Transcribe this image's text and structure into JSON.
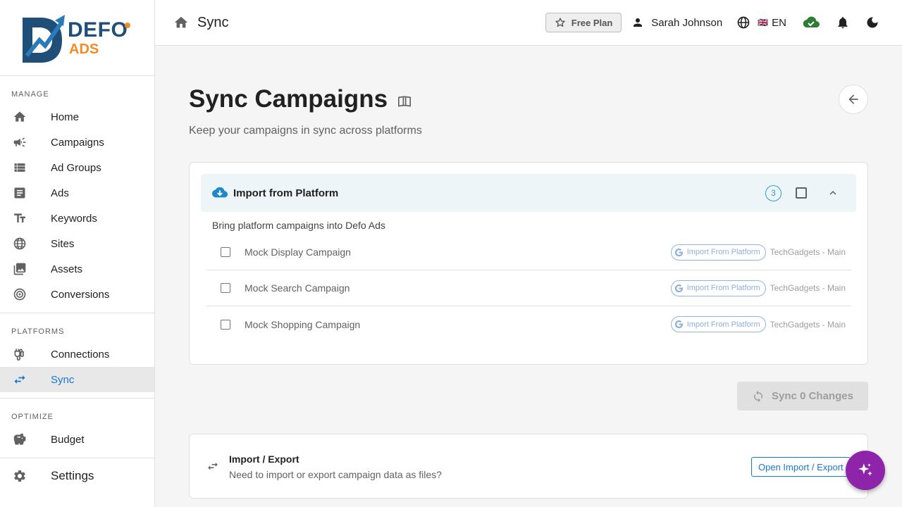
{
  "brand": {
    "name_top": "DEFO",
    "name_bottom": "ADS",
    "primary_color": "#1f4e79",
    "accent_color": "#f28c28"
  },
  "sidebar": {
    "sections": [
      {
        "title": "MANAGE",
        "items": [
          {
            "label": "Home",
            "icon": "home-icon"
          },
          {
            "label": "Campaigns",
            "icon": "megaphone-icon"
          },
          {
            "label": "Ad Groups",
            "icon": "list-icon"
          },
          {
            "label": "Ads",
            "icon": "document-icon"
          },
          {
            "label": "Keywords",
            "icon": "text-icon"
          },
          {
            "label": "Sites",
            "icon": "globe-icon"
          },
          {
            "label": "Assets",
            "icon": "image-icon"
          },
          {
            "label": "Conversions",
            "icon": "target-icon"
          }
        ]
      },
      {
        "title": "PLATFORMS",
        "items": [
          {
            "label": "Connections",
            "icon": "plug-icon"
          },
          {
            "label": "Sync",
            "icon": "sync-arrows-icon",
            "active": true
          }
        ]
      },
      {
        "title": "OPTIMIZE",
        "items": [
          {
            "label": "Budget",
            "icon": "piggy-bank-icon"
          }
        ]
      }
    ],
    "settings_label": "Settings"
  },
  "topbar": {
    "title": "Sync",
    "plan_label": "Free Plan",
    "user_name": "Sarah Johnson",
    "language": "EN",
    "flag": "🇬🇧"
  },
  "page": {
    "title": "Sync Campaigns",
    "subtitle": "Keep your campaigns in sync across platforms"
  },
  "import_card": {
    "title": "Import from Platform",
    "count": "3",
    "description": "Bring platform campaigns into Defo Ads",
    "rows": [
      {
        "name": "Mock Display Campaign",
        "chip": "Import From Platform",
        "account": "TechGadgets - Main"
      },
      {
        "name": "Mock Search Campaign",
        "chip": "Import From Platform",
        "account": "TechGadgets - Main"
      },
      {
        "name": "Mock Shopping Campaign",
        "chip": "Import From Platform",
        "account": "TechGadgets - Main"
      }
    ]
  },
  "sync_button_label": "Sync 0 Changes",
  "import_export": {
    "title": "Import / Export",
    "description": "Need to import or export campaign data as files?",
    "button_label": "Open Import / Export"
  },
  "colors": {
    "active": "#1976d2",
    "fab": "#8e24aa",
    "cloud_ok": "#2e7d32",
    "info": "#29a3c7"
  }
}
